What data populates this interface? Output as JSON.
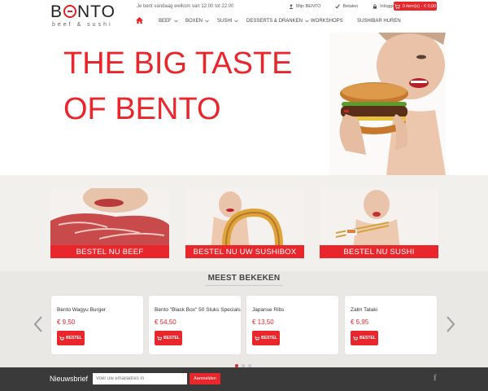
{
  "header": {
    "logo_text": "BENTO",
    "logo_sub": "beef & sushi",
    "welcome": "Je bent vandaag welkom van 12:00 tot 22:00",
    "links": {
      "account": "Mijn BENTO",
      "pay": "Betalen",
      "login": "Inloggen"
    },
    "cart": "0 item(s) - € 0,00"
  },
  "nav": {
    "items": [
      {
        "label": "BEEF",
        "icon": "chevron-down-icon"
      },
      {
        "label": "BOXEN",
        "icon": "chevron-down-icon"
      },
      {
        "label": "SUSHI",
        "icon": "chevron-down-icon"
      },
      {
        "label": "DESSERTS & DRANKEN",
        "icon": "chevron-down-icon"
      },
      {
        "label": "WORKSHOPS"
      },
      {
        "label": "SUSHIBAR HUREN"
      }
    ]
  },
  "hero": {
    "line1": "THE BIG TASTE",
    "line2": "OF BENTO"
  },
  "promos": [
    {
      "label": "BESTEL NU BEEF"
    },
    {
      "label": "BESTEL NU UW SUSHIBOX"
    },
    {
      "label": "BESTEL NU SUSHI"
    }
  ],
  "meest": {
    "title": "MEEST BEKEKEN",
    "products": [
      {
        "name": "Bento Wagyu Burger",
        "price": "€ 9,50",
        "button": "BESTEL"
      },
      {
        "name": "Bento \"Black Box\" 50 Stuks Specials",
        "price": "€ 54,50",
        "button": "BESTEL"
      },
      {
        "name": "Japanse Ribs",
        "price": "€ 13,50",
        "button": "BESTEL"
      },
      {
        "name": "Zalm Tataki",
        "price": "€ 5,95",
        "button": "BESTEL"
      }
    ]
  },
  "footer": {
    "newsletter_label": "Nieuwsbrief",
    "email_placeholder": "Voer uw emailadres in",
    "subscribe": "Aanmelden",
    "social_icon": "facebook-icon"
  },
  "colors": {
    "accent": "#e8262b",
    "band": "#f1f0ed",
    "footer": "#3a3a3a"
  }
}
